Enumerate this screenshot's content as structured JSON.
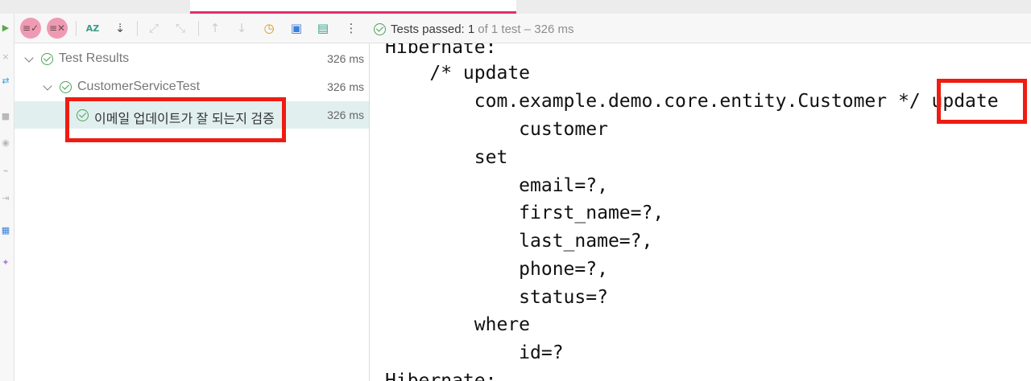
{
  "toolbar": {
    "sort_alpha_label": "AZ",
    "status_prefix": "Tests passed:",
    "status_count": "1",
    "status_suffix": "of 1 test – 326 ms"
  },
  "tree": {
    "rows": [
      {
        "label": "Test Results",
        "time": "326 ms"
      },
      {
        "label": "CustomerServiceTest",
        "time": "326 ms"
      },
      {
        "label": "이메일 업데이트가 잘 되는지 검증",
        "time": "326 ms"
      }
    ]
  },
  "console": {
    "lines": [
      "Hibernate:",
      "    /* update",
      "        com.example.demo.core.entity.Customer */ update",
      "            customer",
      "        set",
      "            email=?,",
      "            first_name=?,",
      "            last_name=?,",
      "            phone=?,",
      "            status=?",
      "        where",
      "            id=?",
      "Hibernate:"
    ]
  },
  "colors": {
    "highlight": "#ee1c12",
    "pass_green": "#4aa359",
    "active_tab": "#e0306b",
    "selected_row": "#e1efef"
  }
}
